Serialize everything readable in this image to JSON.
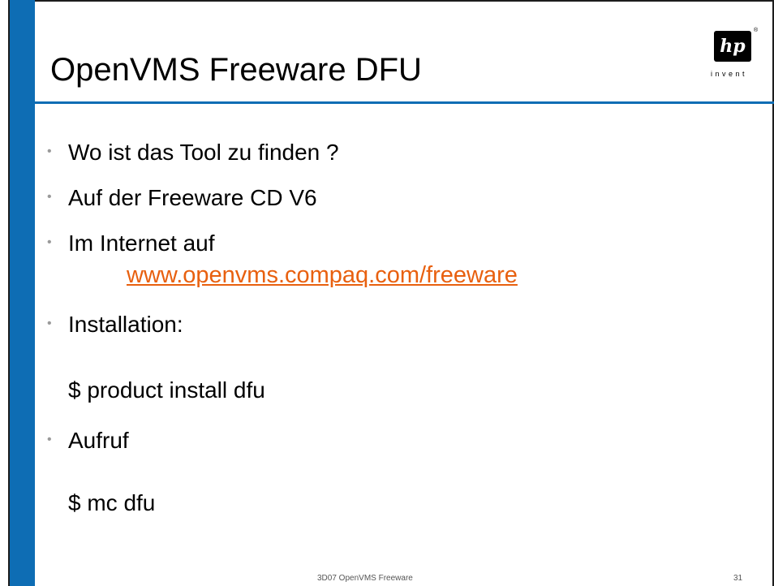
{
  "slide": {
    "title": "OpenVMS Freeware DFU",
    "logo": {
      "mark": "hp",
      "registered": "®",
      "tagline": "invent"
    },
    "bullets": [
      {
        "marker": "•",
        "text": "Wo ist das Tool zu finden ?"
      },
      {
        "marker": "•",
        "text": "Auf der Freeware CD V6"
      },
      {
        "marker": "•",
        "text": "Im Internet auf"
      },
      {
        "marker": "•",
        "text": "Installation:"
      },
      {
        "marker": "•",
        "text": "Aufruf"
      }
    ],
    "link": "www.openvms.compaq.com/freeware",
    "commands": {
      "install": "$ product install dfu",
      "run": "$ mc dfu"
    },
    "footer": {
      "center": "3D07   OpenVMS Freeware",
      "page": "31"
    },
    "colors": {
      "accent_blue": "#0e6db4",
      "link_orange": "#e8600f",
      "bullet_gray": "#9a9a9a"
    }
  }
}
